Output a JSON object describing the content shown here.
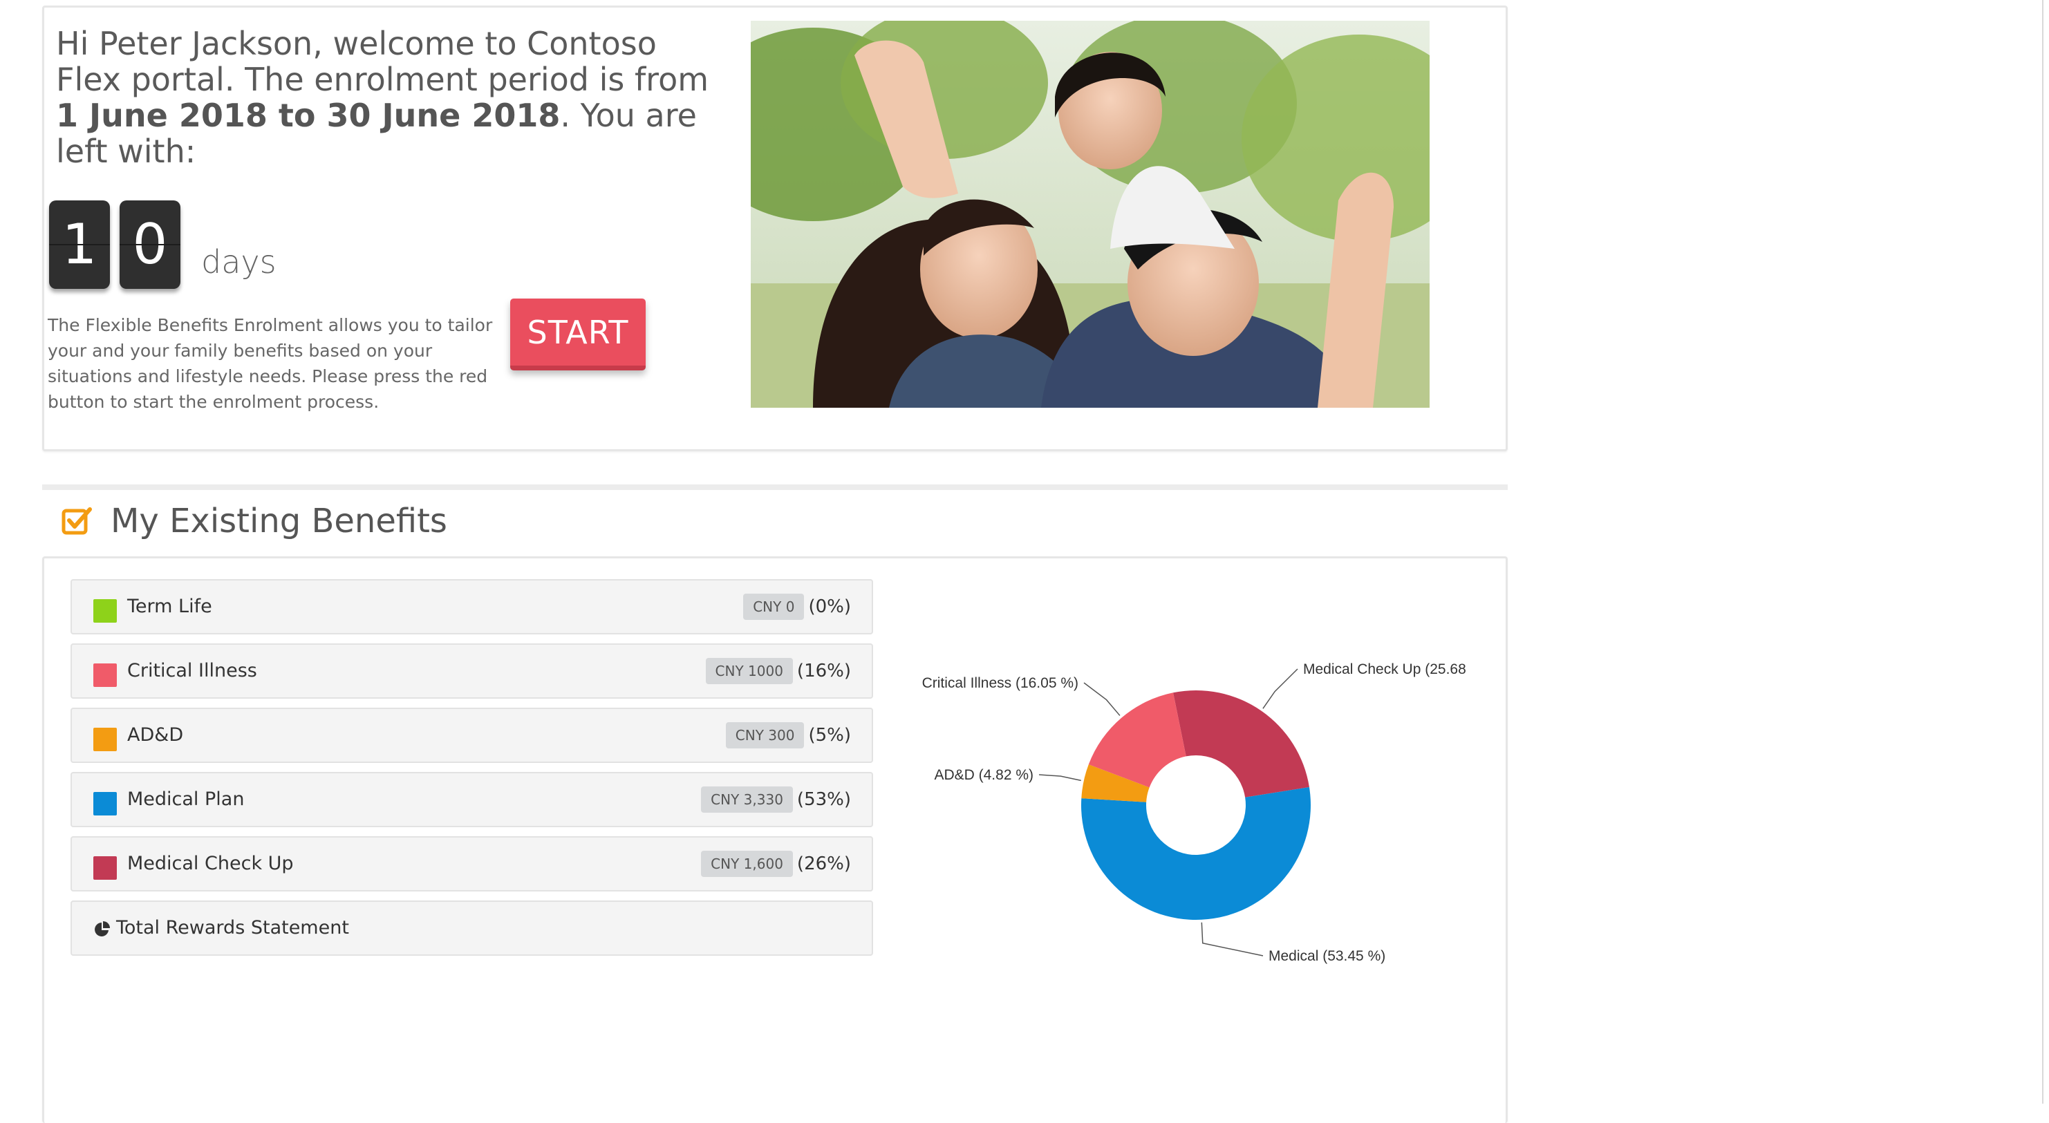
{
  "welcome": {
    "greeting_text": "Hi Peter Jackson, welcome to Contoso Flex portal. The enrolment period is from ",
    "period_text": "1 June 2018 to 30 June 2018",
    "remaining_text": ". You are left with:",
    "countdown_digits": [
      "1",
      "0"
    ],
    "days_label": "days",
    "intro_text": "The Flexible Benefits Enrolment allows you to tailor your and your family benefits based on your situations and lifestyle needs. Please press the red button to start the enrolment process.",
    "start_label": "START"
  },
  "benefits_section": {
    "title": "My Existing Benefits",
    "items": [
      {
        "label": "Term Life",
        "amount": "CNY 0",
        "percent": "(0%)",
        "color": "#8ed21a"
      },
      {
        "label": "Critical Illness",
        "amount": "CNY 1000",
        "percent": "(16%)",
        "color": "#f05b69"
      },
      {
        "label": "AD&D",
        "amount": "CNY 300",
        "percent": "(5%)",
        "color": "#f39c12"
      },
      {
        "label": "Medical Plan",
        "amount": "CNY 3,330",
        "percent": "(53%)",
        "color": "#0b8bd6"
      },
      {
        "label": "Medical Check Up",
        "amount": "CNY 1,600",
        "percent": "(26%)",
        "color": "#c23a54"
      }
    ],
    "total_rewards_label": "Total Rewards Statement"
  },
  "chart_data": {
    "type": "pie",
    "donut": true,
    "title": "",
    "slices": [
      {
        "label": "Medical Check Up (25.68",
        "value": 25.68,
        "color": "#c23a54"
      },
      {
        "label": "Medical (53.45 %)",
        "value": 53.45,
        "color": "#0b8bd6"
      },
      {
        "label": "AD&D (4.82 %)",
        "value": 4.82,
        "color": "#f39c12"
      },
      {
        "label": "Critical Illness (16.05 %)",
        "value": 16.05,
        "color": "#f05b69"
      }
    ]
  }
}
